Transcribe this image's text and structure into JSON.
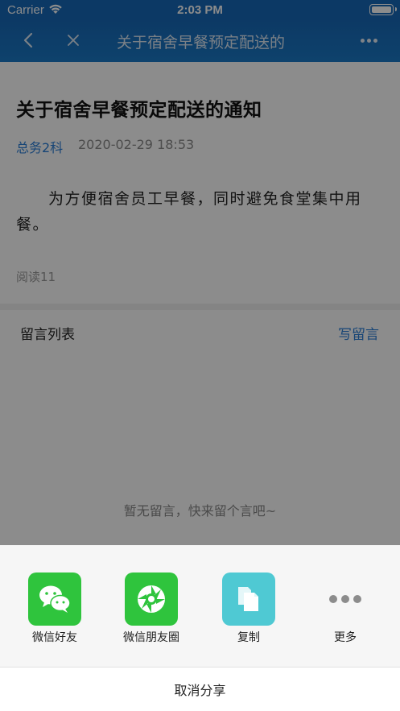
{
  "status_bar": {
    "carrier": "Carrier",
    "time": "2:03 PM"
  },
  "nav": {
    "title": "关于宿舍早餐预定配送的通知"
  },
  "article": {
    "headline": "关于宿舍早餐预定配送的通知",
    "author": "总务2科",
    "date": "2020-02-29 18:53",
    "body": "为方便宿舍员工早餐，同时避免食堂集中用餐。",
    "read_count": "阅读11"
  },
  "comments": {
    "heading": "留言列表",
    "write_label": "写留言",
    "empty_text": "暂无留言，快来留个言吧~"
  },
  "share": {
    "items": [
      {
        "label": "微信好友",
        "icon": "wechat-icon",
        "color": "#2fc43d"
      },
      {
        "label": "微信朋友圈",
        "icon": "moments-icon",
        "color": "#2fc43d"
      },
      {
        "label": "复制",
        "icon": "copy-icon",
        "color": "#4fc9d3"
      },
      {
        "label": "更多",
        "icon": "more-icon",
        "color": "#f6f6f6"
      }
    ],
    "cancel_label": "取消分享"
  },
  "colors": {
    "nav_blue": "#1769b8",
    "accent_blue": "#2a7ed8",
    "wechat_green": "#2fc43d",
    "copy_teal": "#4fc9d3"
  }
}
